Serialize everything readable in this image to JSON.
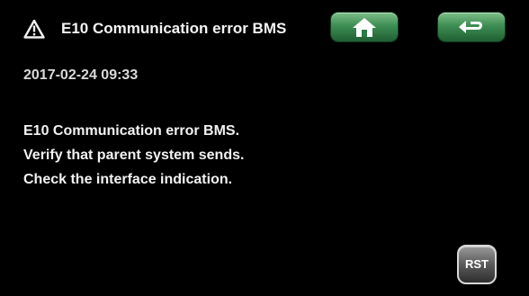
{
  "header": {
    "icon": "warning-triangle-icon",
    "title": "E10 Communication error BMS",
    "home_icon": "home-icon",
    "back_icon": "back-arrow-icon"
  },
  "event": {
    "timestamp": "2017-02-24 09:33"
  },
  "message": {
    "lines": [
      "E10 Communication error BMS.",
      "Verify that parent system sends.",
      "Check the interface indication."
    ]
  },
  "reset_button": {
    "label": "RST"
  },
  "colors": {
    "background": "#000000",
    "button_green": "#3e8e53",
    "text": "#f2f2f2"
  }
}
